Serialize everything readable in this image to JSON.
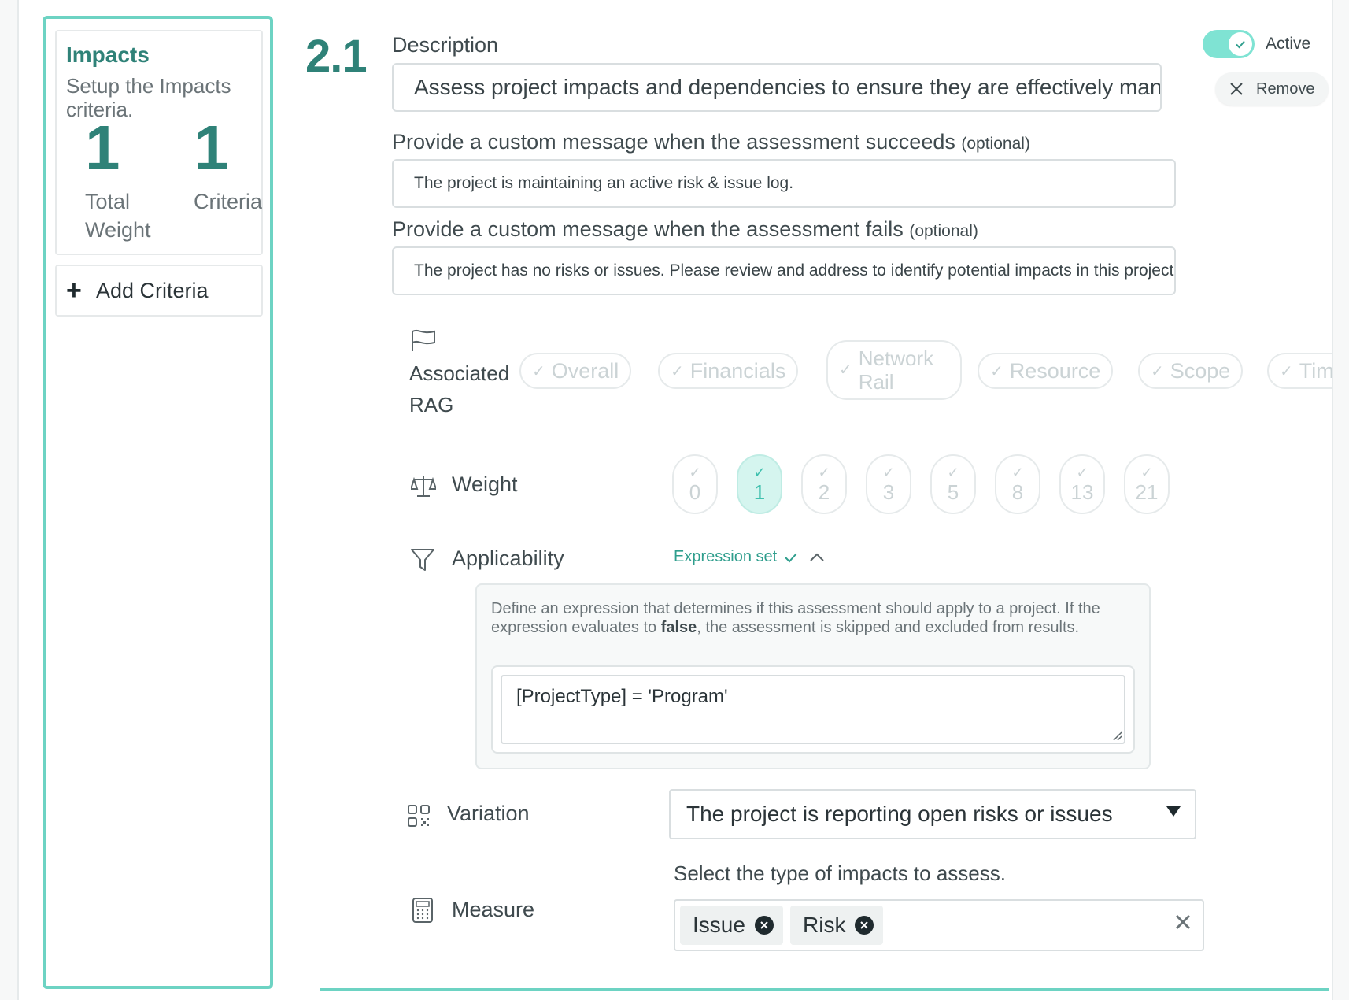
{
  "sidebar": {
    "title": "Impacts",
    "subtitle": "Setup the Impacts criteria.",
    "stats": [
      {
        "value": "1",
        "label": "Total Weight"
      },
      {
        "value": "1",
        "label": "Criteria"
      }
    ],
    "add_label": "Add Criteria"
  },
  "criteria": {
    "number": "2.1",
    "description_label": "Description",
    "description_value": "Assess project impacts and dependencies to ensure they are effectively managed.",
    "success_label": "Provide a custom message when the assessment succeeds",
    "success_optional": "(optional)",
    "success_value": "The project is maintaining an active risk & issue log.",
    "fail_label": "Provide a custom message when the assessment fails",
    "fail_optional": "(optional)",
    "fail_value": "The project has no risks or issues. Please review and address to identify potential impacts in this project.",
    "active_label": "Active",
    "active": true,
    "remove_label": "Remove"
  },
  "rag": {
    "label": "Associated RAG",
    "options": [
      "Overall",
      "Financials",
      "Network Rail",
      "Resource",
      "Scope",
      "Timeline"
    ]
  },
  "weight": {
    "label": "Weight",
    "options": [
      "0",
      "1",
      "2",
      "3",
      "5",
      "8",
      "13",
      "21"
    ],
    "selected": "1"
  },
  "applicability": {
    "label": "Applicability",
    "status": "Expression set",
    "desc_part1": "Define an expression that determines if this assessment should apply to a project. If the expression evaluates to ",
    "desc_bold": "false",
    "desc_part2": ", the assessment is skipped and excluded from results.",
    "expression": "[ProjectType] = 'Program'"
  },
  "variation": {
    "label": "Variation",
    "selected": "The project is reporting open risks or issues"
  },
  "measure": {
    "label": "Measure",
    "hint": "Select the type of impacts to assess.",
    "tags": [
      "Issue",
      "Risk"
    ]
  },
  "colors": {
    "accent": "#2f8278",
    "highlight": "#6dd3c3",
    "toggle": "#7fe3d3"
  }
}
